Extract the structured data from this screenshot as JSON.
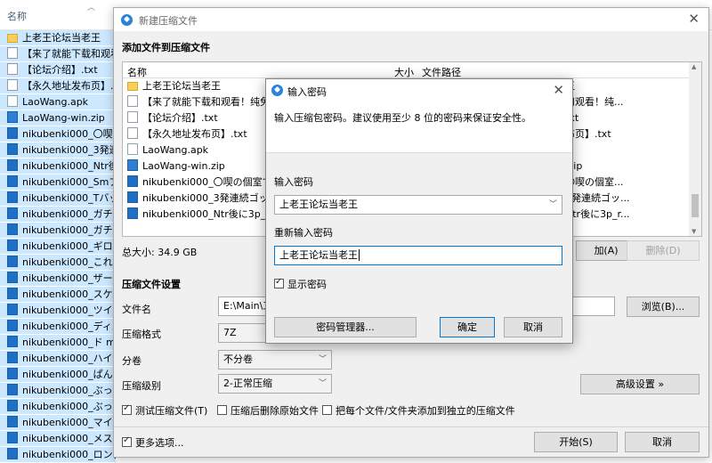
{
  "explorer": {
    "col_name": "名称",
    "rows": [
      {
        "icon": "folder",
        "label": "上老王论坛当老王",
        "sel": true
      },
      {
        "icon": "file",
        "label": "【来了就能下载和观看！",
        "sel": true
      },
      {
        "icon": "file",
        "label": "【论坛介绍】.txt",
        "sel": true
      },
      {
        "icon": "file",
        "label": "【永久地址发布页】.tx",
        "sel": true
      },
      {
        "icon": "apk",
        "label": "LaoWang.apk",
        "sel": true
      },
      {
        "icon": "zip",
        "label": "LaoWang-win.zip",
        "sel": true
      },
      {
        "icon": "vid",
        "label": "nikubenki000_〇喫の",
        "sel": true
      },
      {
        "icon": "vid",
        "label": "nikubenki000_3発連続",
        "sel": true
      },
      {
        "icon": "vid",
        "label": "nikubenki000_Ntr後に",
        "sel": true
      },
      {
        "icon": "vid",
        "label": "nikubenki000_Smプレ",
        "sel": true
      },
      {
        "icon": "vid",
        "label": "nikubenki000_Tバック",
        "sel": true
      },
      {
        "icon": "vid",
        "label": "nikubenki000_ガチイ",
        "sel": true
      },
      {
        "icon": "vid",
        "label": "nikubenki000_ガチフ",
        "sel": true
      },
      {
        "icon": "vid",
        "label": "nikubenki000_ギロチン",
        "sel": true
      },
      {
        "icon": "vid",
        "label": "nikubenki000_これが",
        "sel": true
      },
      {
        "icon": "vid",
        "label": "nikubenki000_ザーメ",
        "sel": true
      },
      {
        "icon": "vid",
        "label": "nikubenki000_スケスケ",
        "sel": true
      },
      {
        "icon": "vid",
        "label": "nikubenki000_ツインテ",
        "sel": true
      },
      {
        "icon": "vid",
        "label": "nikubenki000_ディル",
        "sel": true
      },
      {
        "icon": "vid",
        "label": "nikubenki000_ド m性",
        "sel": true
      },
      {
        "icon": "vid",
        "label": "nikubenki000_ハイレグ",
        "sel": true
      },
      {
        "icon": "vid",
        "label": "nikubenki000_ぱんぴ",
        "sel": true
      },
      {
        "icon": "vid",
        "label": "nikubenki000_ぶっか",
        "sel": true
      },
      {
        "icon": "vid",
        "label": "nikubenki000_ぶっか",
        "sel": true
      },
      {
        "icon": "vid",
        "label": "nikubenki000_マイクロ",
        "sel": true
      },
      {
        "icon": "vid",
        "label": "nikubenki000_メス牛",
        "sel": true
      },
      {
        "icon": "vid",
        "label": "nikubenki000_ロング",
        "sel": true
      }
    ]
  },
  "dialog": {
    "title": "新建压缩文件",
    "section_add": "添加文件到压缩文件",
    "col_name": "名称",
    "col_size": "大小",
    "col_path": "文件路径",
    "files": [
      {
        "icon": "folder",
        "name": "上老王论坛当老王",
        "path": "王"
      },
      {
        "icon": "file",
        "name": "【来了就能下载和观看！纯免费！",
        "path": "和观看！纯..."
      },
      {
        "icon": "file",
        "name": "【论坛介绍】.txt",
        "path": "txt"
      },
      {
        "icon": "file",
        "name": "【永久地址发布页】.txt",
        "path": "布页】.txt"
      },
      {
        "icon": "apk",
        "name": "LaoWang.apk",
        "path": ""
      },
      {
        "icon": "zip",
        "name": "LaoWang-win.zip",
        "path": ".zip"
      },
      {
        "icon": "vid",
        "name": "nikubenki000_〇喫の個室でス...",
        "path": "〇喫の個室..."
      },
      {
        "icon": "vid",
        "name": "nikubenki000_3発連続ゴックン",
        "path": "3発連続ゴッ..."
      },
      {
        "icon": "vid",
        "name": "nikubenki000_Ntr後に3p_restc",
        "path": "Ntr後に3p_r..."
      }
    ],
    "total_size": "总大小: 34.9 GB",
    "add_btn": "加(A)",
    "delete_btn": "删除(D)",
    "section_settings": "压缩文件设置",
    "filename_label": "文件名",
    "filename_value": "E:\\Main\\工",
    "format_label": "压缩格式",
    "format_value": "7Z",
    "split_label": "分卷",
    "split_value": "不分卷",
    "level_label": "压缩级别",
    "level_value": "2-正常压缩",
    "browse_btn": "浏览(B)...",
    "advanced_btn": "高级设置 »",
    "test_chk": "测试压缩文件(T)",
    "delete_chk": "压缩后删除原始文件",
    "separate_chk": "把每个文件/文件夹添加到独立的压缩文件",
    "more_chk": "更多选项...",
    "start_btn": "开始(S)",
    "cancel_btn": "取消"
  },
  "password": {
    "title": "输入密码",
    "hint": "输入压缩包密码。建议使用至少 8 位的密码来保证安全性。",
    "enter_label": "输入密码",
    "enter_value": "上老王论坛当老王",
    "reenter_label": "重新输入密码",
    "reenter_value": "上老王论坛当老王",
    "show_chk": "显示密码",
    "manager_btn": "密码管理器...",
    "ok_btn": "确定",
    "cancel_btn": "取消"
  }
}
